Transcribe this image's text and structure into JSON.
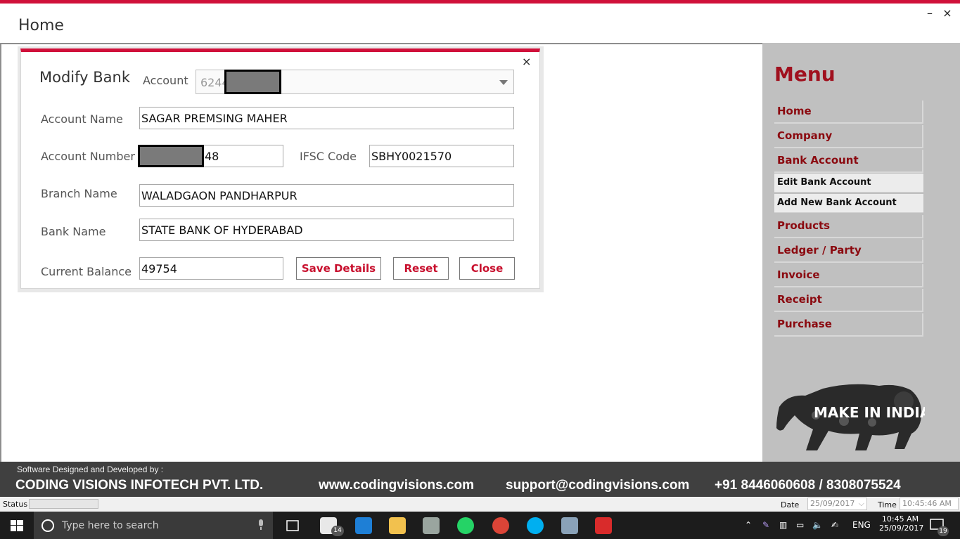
{
  "window": {
    "title": "Home",
    "minimize_label": "–",
    "close_label": "×"
  },
  "dialog": {
    "title": "Modify Bank",
    "close_label": "×",
    "account_label": "Account",
    "account_value": "6244",
    "account_name_label": "Account Name",
    "account_name_value": "SAGAR PREMSING MAHER",
    "account_number_label": "Account Number",
    "account_number_value": "48",
    "ifsc_label": "IFSC Code",
    "ifsc_value": "SBHY0021570",
    "branch_label": "Branch Name",
    "branch_value": "WALADGAON PANDHARPUR",
    "bank_label": "Bank Name",
    "bank_value": "STATE BANK OF HYDERABAD",
    "balance_label": "Current Balance",
    "balance_value": "49754",
    "save_label": "Save Details",
    "reset_label": "Reset",
    "close_button_label": "Close"
  },
  "menu": {
    "title": "Menu",
    "items": [
      {
        "label": "Home"
      },
      {
        "label": "Company"
      },
      {
        "label": "Bank Account"
      },
      {
        "label": "Edit Bank Account"
      },
      {
        "label": "Add New Bank Account"
      },
      {
        "label": "Products"
      },
      {
        "label": "Ledger / Party"
      },
      {
        "label": "Invoice"
      },
      {
        "label": "Receipt"
      },
      {
        "label": "Purchase"
      }
    ],
    "logo_text": "MAKE IN INDIA"
  },
  "footer": {
    "credit": "Software Designed and Developed by :",
    "company": "CODING VISIONS INFOTECH PVT. LTD.",
    "website": "www.codingvisions.com",
    "email": "support@codingvisions.com",
    "phone": "+91 8446060608 / 8308075524"
  },
  "status": {
    "status_label": "Status",
    "date_label": "Date",
    "date_value": "25/09/2017",
    "time_label": "Time",
    "time_value": "10:45:46 AM"
  },
  "taskbar": {
    "search_placeholder": "Type here to search",
    "mail_badge": "14",
    "language": "ENG",
    "clock_time": "10:45 AM",
    "clock_date": "25/09/2017",
    "notification_count": "19"
  }
}
